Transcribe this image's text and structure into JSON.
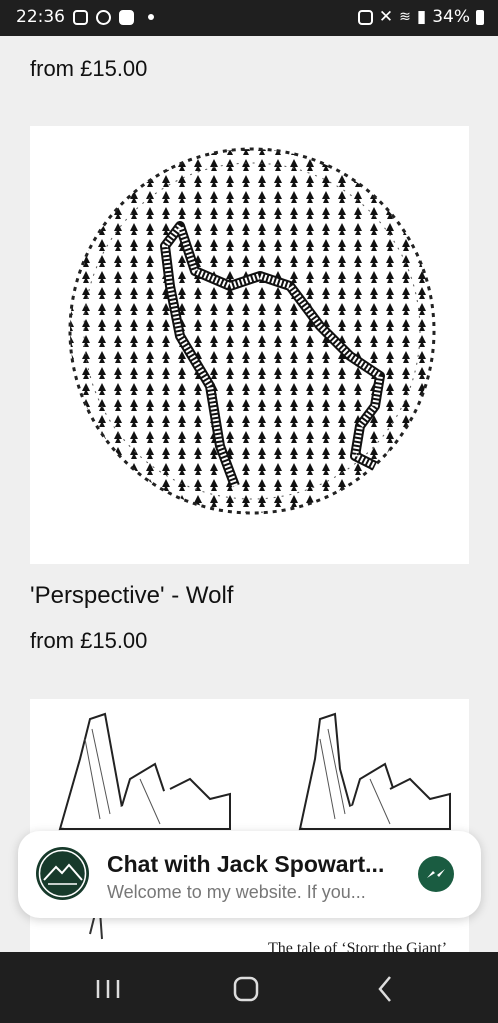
{
  "status_bar": {
    "time": "22:36",
    "battery": "34%"
  },
  "products": [
    {
      "title": "",
      "price": "from £15.00"
    },
    {
      "title": "'Perspective' - Wolf",
      "price": "from £15.00"
    },
    {
      "title": "",
      "price": "",
      "caption": "The tale of ‘Storr the Giant’"
    }
  ],
  "chat": {
    "title": "Chat with Jack Spowart...",
    "subtitle": "Welcome to my website. If you..."
  },
  "icons": [
    "instagram-icon",
    "chrome-icon",
    "check-icon",
    "lock-icon",
    "mute-icon",
    "wifi-icon",
    "signal-icon",
    "battery-icon",
    "messenger-icon",
    "recent-apps-icon",
    "home-icon",
    "back-icon"
  ]
}
